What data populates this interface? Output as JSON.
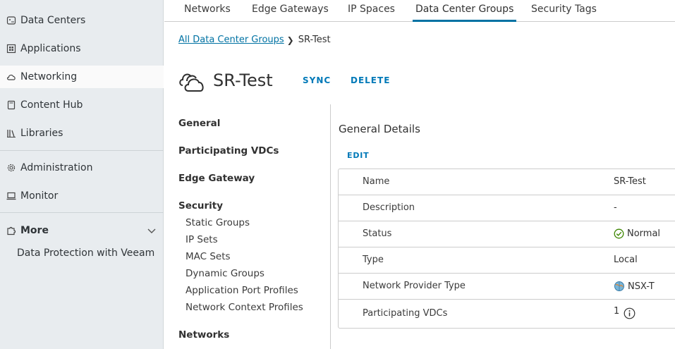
{
  "sidebar": {
    "items": [
      {
        "label": "Data Centers",
        "icon": "data-center-icon"
      },
      {
        "label": "Applications",
        "icon": "applications-icon"
      },
      {
        "label": "Networking",
        "icon": "cloud-network-icon"
      },
      {
        "label": "Content Hub",
        "icon": "content-hub-icon"
      },
      {
        "label": "Libraries",
        "icon": "libraries-icon"
      },
      {
        "label": "Administration",
        "icon": "gear-icon"
      },
      {
        "label": "Monitor",
        "icon": "monitor-icon"
      },
      {
        "label": "More",
        "icon": "puzzle-icon"
      }
    ],
    "sub_item": "Data Protection with Veeam"
  },
  "tabs": [
    "Networks",
    "Edge Gateways",
    "IP Spaces",
    "Data Center Groups",
    "Security Tags"
  ],
  "breadcrumb": {
    "link": "All Data Center Groups",
    "current": "SR-Test"
  },
  "title": "SR-Test",
  "actions": {
    "sync": "SYNC",
    "delete": "DELETE"
  },
  "vnav": {
    "general": "General",
    "participating": "Participating VDCs",
    "edge_gateway": "Edge Gateway",
    "security": "Security",
    "security_items": [
      "Static Groups",
      "IP Sets",
      "MAC Sets",
      "Dynamic Groups",
      "Application Port Profiles",
      "Network Context Profiles"
    ],
    "networks": "Networks"
  },
  "details": {
    "title": "General Details",
    "edit": "EDIT",
    "rows": [
      {
        "label": "Name",
        "value": "SR-Test"
      },
      {
        "label": "Description",
        "value": "-"
      },
      {
        "label": "Status",
        "value": "Normal"
      },
      {
        "label": "Type",
        "value": "Local"
      },
      {
        "label": "Network Provider Type",
        "value": "NSX-T"
      },
      {
        "label": "Participating VDCs",
        "value": "1"
      }
    ]
  },
  "colors": {
    "accent": "#0072a3",
    "status_ok": "#3c8500",
    "sidebar_bg": "#e8ecef"
  }
}
